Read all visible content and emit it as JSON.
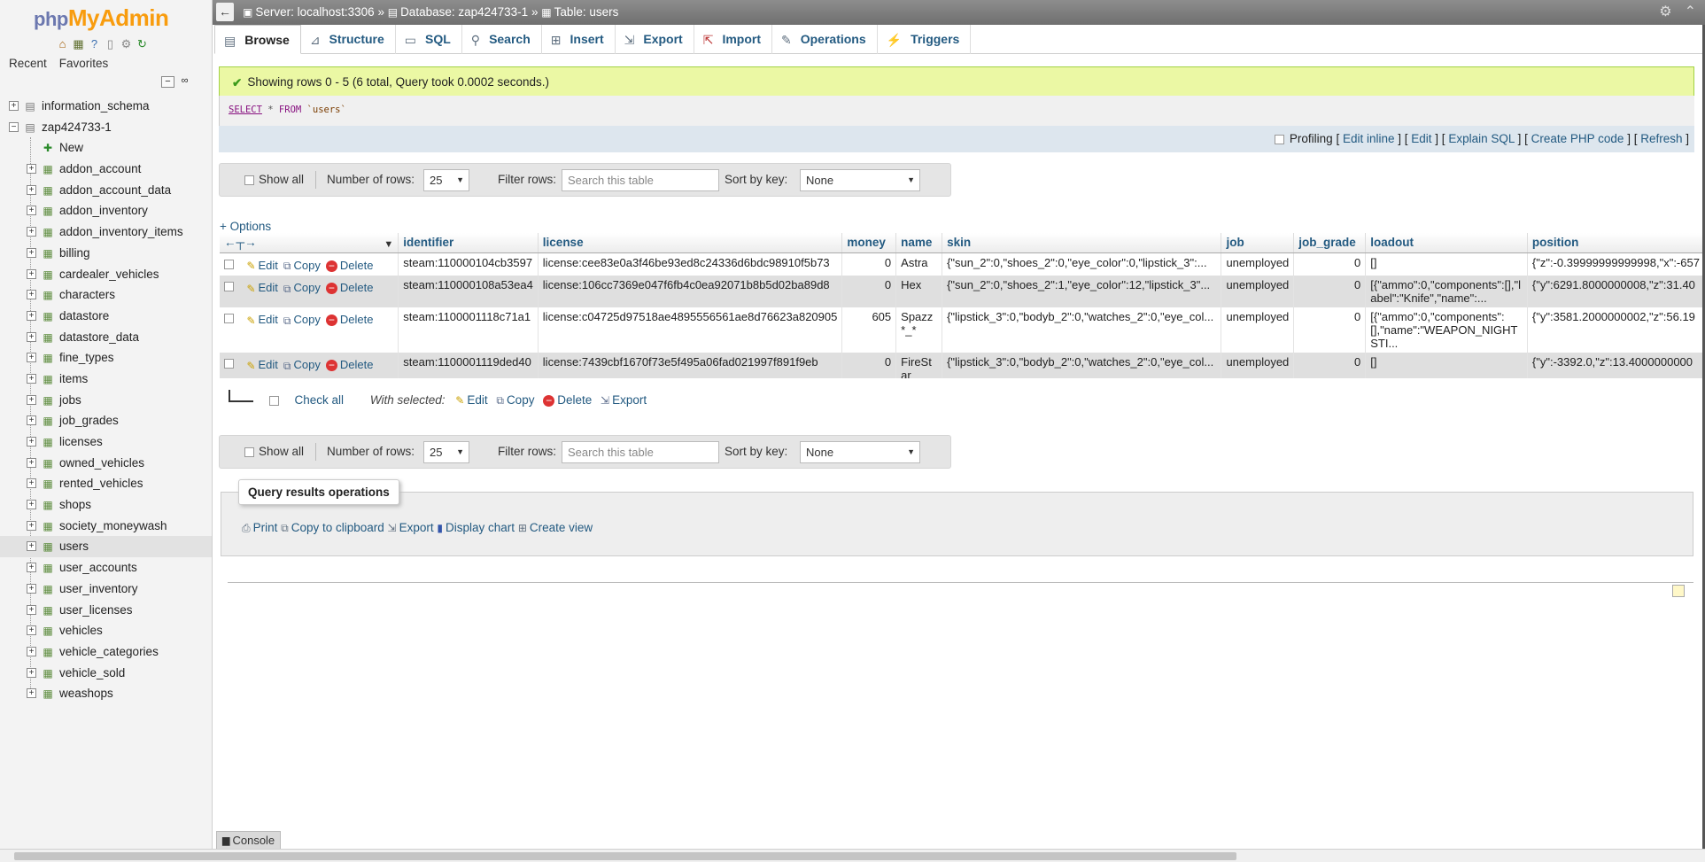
{
  "logo": {
    "php": "php",
    "my": "My",
    "admin": "Admin"
  },
  "nav_icons": [
    "home-icon",
    "db-icon",
    "help-icon",
    "docs-icon",
    "settings-icon",
    "reload-icon"
  ],
  "nav_tabs": {
    "recent": "Recent",
    "favorites": "Favorites"
  },
  "tree": {
    "databases": [
      {
        "name": "information_schema",
        "expander": "+"
      },
      {
        "name": "zap424733-1",
        "expander": "−"
      }
    ],
    "new_label": "New",
    "tables": [
      "addon_account",
      "addon_account_data",
      "addon_inventory",
      "addon_inventory_items",
      "billing",
      "cardealer_vehicles",
      "characters",
      "datastore",
      "datastore_data",
      "fine_types",
      "items",
      "jobs",
      "job_grades",
      "licenses",
      "owned_vehicles",
      "rented_vehicles",
      "shops",
      "society_moneywash",
      "users",
      "user_accounts",
      "user_inventory",
      "user_licenses",
      "vehicles",
      "vehicle_categories",
      "vehicle_sold",
      "weashops"
    ],
    "selected_table": "users"
  },
  "topbar": {
    "server": "Server: localhost:3306",
    "database": "Database: zap424733-1",
    "table": "Table: users",
    "sep": "»"
  },
  "tabs": [
    "Browse",
    "Structure",
    "SQL",
    "Search",
    "Insert",
    "Export",
    "Import",
    "Operations",
    "Triggers"
  ],
  "active_tab": "Browse",
  "success_message": "Showing rows 0 - 5 (6 total, Query took 0.0002 seconds.)",
  "sql": {
    "select": "SELECT",
    "star": "*",
    "from": "FROM",
    "table": "`users`"
  },
  "profiling": {
    "label": "Profiling",
    "links": [
      "Edit inline",
      "Edit",
      "Explain SQL",
      "Create PHP code",
      "Refresh"
    ]
  },
  "navbar": {
    "show_all": "Show all",
    "rows_label": "Number of rows:",
    "rows_value": "25",
    "filter_label": "Filter rows:",
    "filter_placeholder": "Search this table",
    "sort_label": "Sort by key:",
    "sort_value": "None"
  },
  "options_link": "+ Options",
  "columns": [
    "identifier",
    "license",
    "money",
    "name",
    "skin",
    "job",
    "job_grade",
    "loadout",
    "position"
  ],
  "row_actions": {
    "edit": "Edit",
    "copy": "Copy",
    "delete": "Delete"
  },
  "rows": [
    {
      "identifier": "steam:110000104cb3597",
      "license": "license:cee83e0a3f46be93ed8c24336d6bdc98910f5b73",
      "money": "0",
      "name": "Astra",
      "skin": "{\"sun_2\":0,\"shoes_2\":0,\"eye_color\":0,\"lipstick_3\":...",
      "job": "unemployed",
      "job_grade": "0",
      "loadout": "[]",
      "position": "{\"z\":-0.39999999999998,\"x\":-657"
    },
    {
      "identifier": "steam:110000108a53ea4",
      "license": "license:106cc7369e047f6fb4c0ea92071b8b5d02ba89d8",
      "money": "0",
      "name": "Hex",
      "skin": "{\"sun_2\":0,\"shoes_2\":1,\"eye_color\":12,\"lipstick_3\"...",
      "job": "unemployed",
      "job_grade": "0",
      "loadout": "[{\"ammo\":0,\"components\":[],\"label\":\"Knife\",\"name\":...",
      "position": "{\"y\":6291.8000000008,\"z\":31.40"
    },
    {
      "identifier": "steam:1100001118c71a1",
      "license": "license:c04725d97518ae4895556561ae8d76623a820905",
      "money": "605",
      "name": "Spazz *_*",
      "skin": "{\"lipstick_3\":0,\"bodyb_2\":0,\"watches_2\":0,\"eye_col...",
      "job": "unemployed",
      "job_grade": "0",
      "loadout": "[{\"ammo\":0,\"components\":[],\"name\":\"WEAPON_NIGHTSTI...",
      "position": "{\"y\":3581.2000000002,\"z\":56.19"
    },
    {
      "identifier": "steam:1100001119ded40",
      "license": "license:7439cbf1670f73e5f495a06fad021997f891f9eb",
      "money": "0",
      "name": "FireStar",
      "skin": "{\"lipstick_3\":0,\"bodyb_2\":0,\"watches_2\":0,\"eye_col...",
      "job": "unemployed",
      "job_grade": "0",
      "loadout": "[]",
      "position": "{\"y\":-3392.0,\"z\":13.4000000000"
    }
  ],
  "bulk": {
    "check_all": "Check all",
    "with_selected": "With selected:",
    "edit": "Edit",
    "copy": "Copy",
    "delete": "Delete",
    "export": "Export"
  },
  "query_ops": {
    "legend": "Query results operations",
    "print": "Print",
    "copy_clipboard": "Copy to clipboard",
    "export": "Export",
    "display_chart": "Display chart",
    "create_view": "Create view"
  },
  "console": "Console"
}
